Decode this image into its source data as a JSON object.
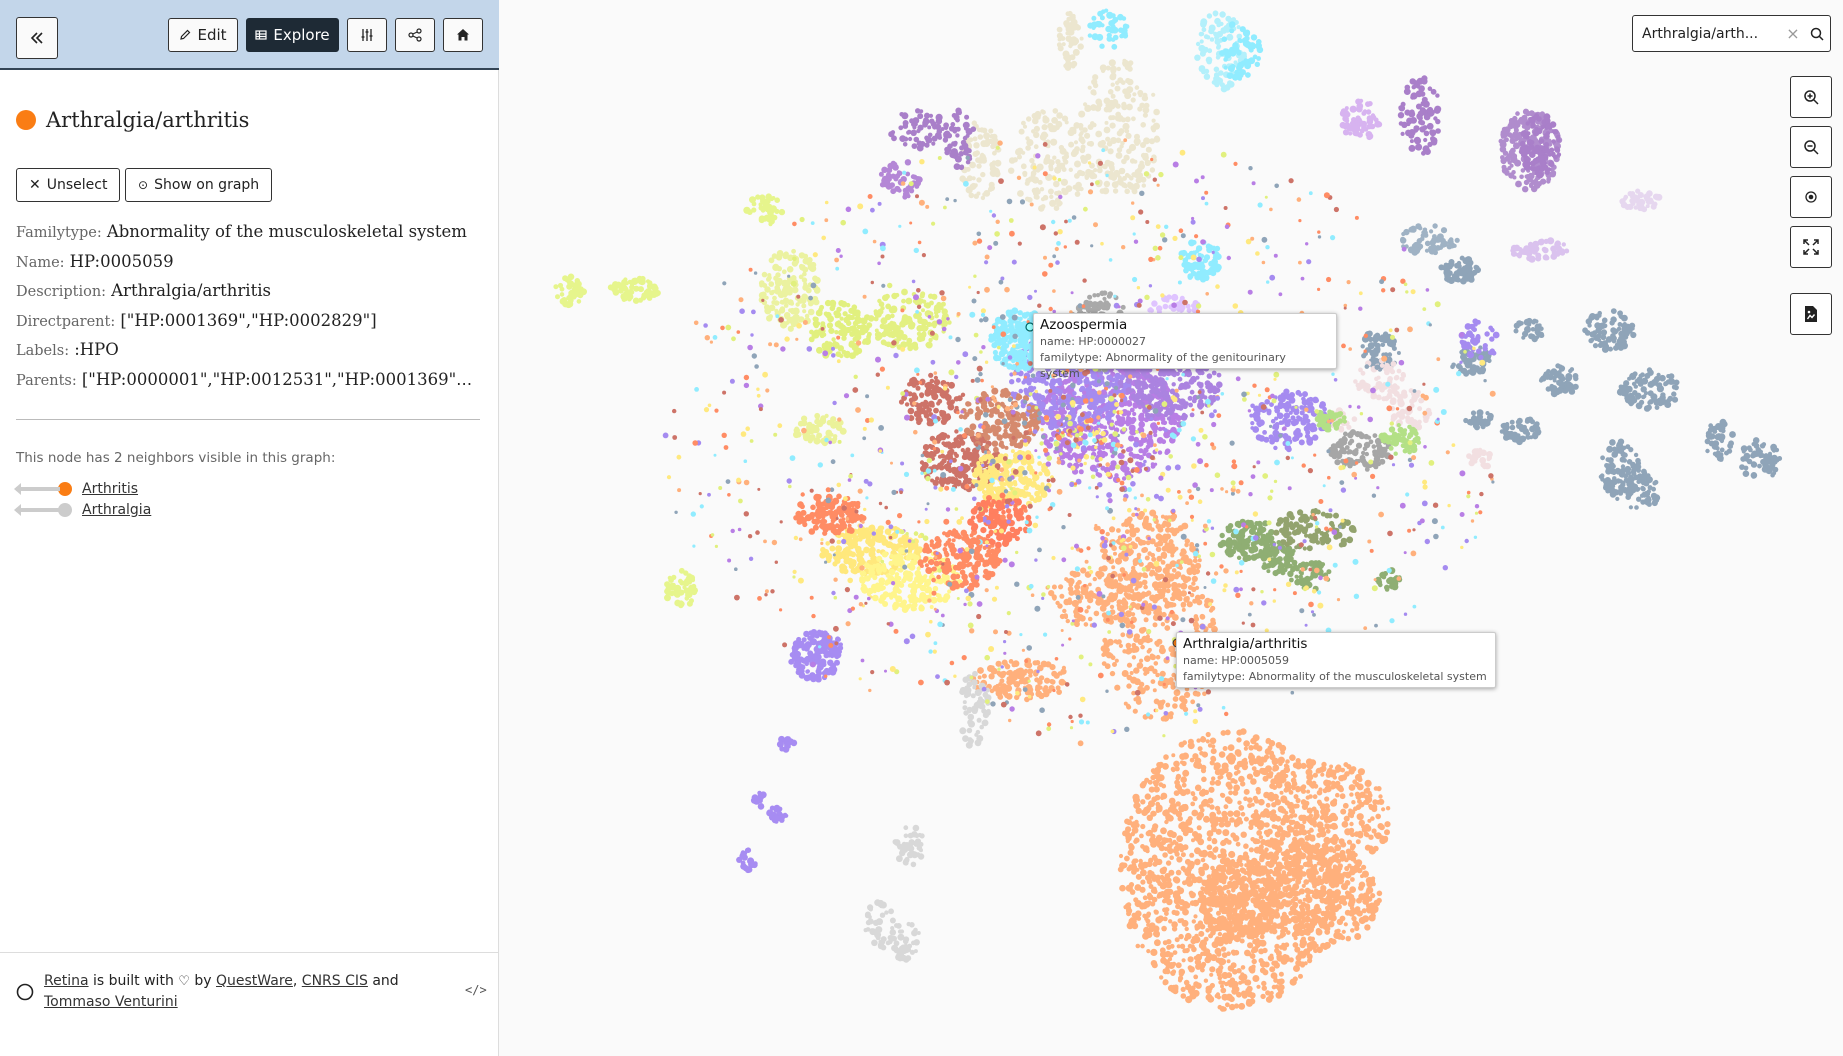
{
  "toolbar": {
    "collapse_icon": "double-chevron-left-icon",
    "edit_label": "Edit",
    "explore_label": "Explore",
    "settings_icon": "sliders-icon",
    "share_icon": "share-icon",
    "home_icon": "home-icon"
  },
  "node": {
    "title": "Arthralgia/arthritis",
    "color": "#fa7d14",
    "unselect_label": "Unselect",
    "show_on_graph_label": "Show on graph",
    "properties": [
      {
        "key": "Familytype:",
        "value": "Abnormality of the musculoskeletal system"
      },
      {
        "key": "Name:",
        "value": "HP:0005059"
      },
      {
        "key": "Description:",
        "value": "Arthralgia/arthritis"
      },
      {
        "key": "Directparent:",
        "value": "[\"HP:0001369\",\"HP:0002829\"]"
      },
      {
        "key": "Labels:",
        "value": ":HPO"
      },
      {
        "key": "Parents:",
        "value": "[\"HP:0000001\",\"HP:0012531\",\"HP:0001369\",\"HP:0002829\"]"
      }
    ]
  },
  "neighbors": {
    "intro": "This node has 2 neighbors visible in this graph:",
    "items": [
      {
        "label": "Arthritis",
        "color": "#fa7d14"
      },
      {
        "label": "Arthralgia",
        "color": "#cccccc"
      }
    ]
  },
  "footer": {
    "retina": "Retina",
    "built_with": " is built with ",
    "by": " by ",
    "questware": "QuestWare",
    "comma": ", ",
    "cnrs": "CNRS CIS",
    "and": " and ",
    "tommaso": "Tommaso Venturini",
    "embed_icon": "code-icon"
  },
  "search": {
    "value": "Arthralgia/arth...",
    "clear": "×"
  },
  "graph_controls": [
    "zoom-in-icon",
    "zoom-out-icon",
    "center-icon",
    "fullscreen-icon",
    "export-image-icon"
  ],
  "tooltips": [
    {
      "title": "Azoospermia",
      "name": "name: HP:0000027",
      "familytype": "familytype: Abnormality of the genitourinary system"
    },
    {
      "title": "Arthralgia/arthritis",
      "name": "name: HP:0005059",
      "familytype": "familytype: Abnormality of the musculoskeletal system"
    }
  ],
  "colors": {
    "accent": "#fa7d14",
    "header_bg": "#c3d6ea",
    "dark_button": "#1e2a35"
  }
}
